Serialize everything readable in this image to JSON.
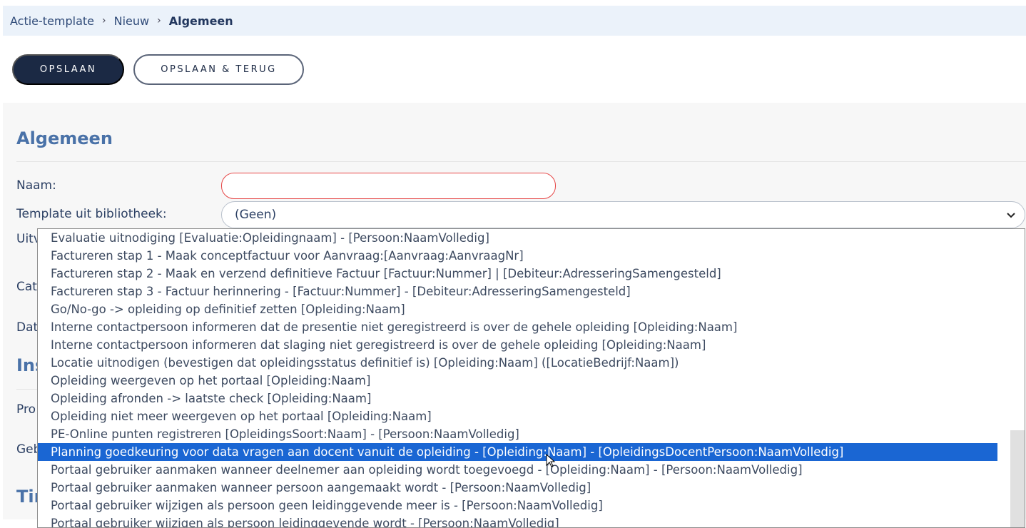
{
  "breadcrumb": {
    "items": [
      "Actie-template",
      "Nieuw"
    ],
    "current": "Algemeen",
    "separator": "›"
  },
  "toolbar": {
    "save_label": "OPSLAAN",
    "save_back_label": "OPSLAAN & TERUG"
  },
  "section": {
    "title": "Algemeen"
  },
  "form": {
    "naam_label": "Naam:",
    "naam_value": "",
    "template_label": "Template uit bibliotheek:",
    "template_value": "(Geen)"
  },
  "obscured_labels": {
    "uitv": "Uitv",
    "cat": "Cat",
    "dat": "Dat",
    "ins": "Ins",
    "pro": "Pro",
    "geb": "Geb",
    "tin": "Tin"
  },
  "dropdown": {
    "options": [
      "Evaluatie uitnodiging [Evaluatie:Opleidingnaam] - [Persoon:NaamVolledig]",
      "Factureren stap 1 - Maak conceptfactuur voor Aanvraag:[Aanvraag:AanvraagNr]",
      "Factureren stap 2 - Maak en verzend definitieve Factuur [Factuur:Nummer] | [Debiteur:AdresseringSamengesteld]",
      "Factureren stap 3 - Factuur herinnering - [Factuur:Nummer] - [Debiteur:AdresseringSamengesteld]",
      "Go/No-go -> opleiding op definitief zetten [Opleiding:Naam]",
      "Interne contactpersoon informeren dat de presentie niet geregistreerd is over de gehele opleiding [Opleiding:Naam]",
      "Interne contactpersoon informeren dat slaging niet geregistreerd is over de gehele opleiding [Opleiding:Naam]",
      "Locatie uitnodigen (bevestigen dat opleidingsstatus definitief is) [Opleiding:Naam] ([LocatieBedrijf:Naam])",
      "Opleiding weergeven op het portaal [Opleiding:Naam]",
      "Opleiding afronden -> laatste check [Opleiding:Naam]",
      "Opleiding niet meer weergeven op het portaal [Opleiding:Naam]",
      "PE-Online punten registreren [OpleidingsSoort:Naam] - [Persoon:NaamVolledig]",
      "Planning goedkeuring voor data vragen aan docent vanuit de opleiding - [Opleiding:Naam] - [OpleidingsDocentPersoon:NaamVolledig]",
      "Portaal gebruiker aanmaken wanneer deelnemer aan opleiding wordt toegevoegd - [Opleiding:Naam] - [Persoon:NaamVolledig]",
      "Portaal gebruiker aanmaken wanneer persoon aangemaakt wordt - [Persoon:NaamVolledig]",
      "Portaal gebruiker wijzigen als persoon geen leidinggevende meer is - [Persoon:NaamVolledig]",
      "Portaal gebruiker wijzigen als persoon leidinggevende wordt - [Persoon:NaamVolledig]"
    ],
    "selected_index": 12
  },
  "colors": {
    "primary": "#1b2944",
    "accent": "#1a66d3",
    "heading": "#4a72a8",
    "error_border": "#e64545",
    "breadcrumb_bg": "#ebf2fa"
  },
  "icons": {
    "select_arrow": "chevron-down-icon",
    "cursor": "mouse-pointer-icon"
  }
}
